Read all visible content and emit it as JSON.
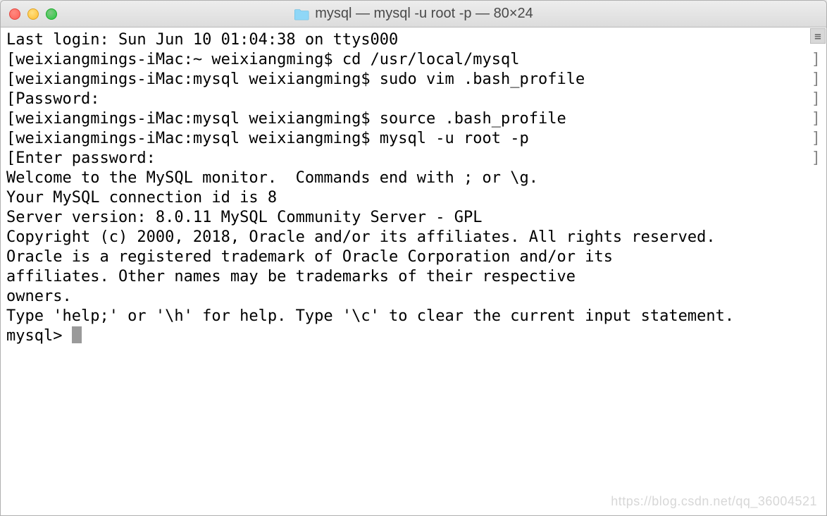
{
  "titlebar": {
    "title": "mysql — mysql -u root -p — 80×24",
    "folder_icon": "folder-icon"
  },
  "terminal": {
    "lines": [
      {
        "bracket": false,
        "text": "Last login: Sun Jun 10 01:04:38 on ttys000"
      },
      {
        "bracket": true,
        "text": "weixiangmings-iMac:~ weixiangming$ cd /usr/local/mysql"
      },
      {
        "bracket": true,
        "text": "weixiangmings-iMac:mysql weixiangming$ sudo vim .bash_profile"
      },
      {
        "bracket": true,
        "text": "Password:"
      },
      {
        "bracket": true,
        "text": "weixiangmings-iMac:mysql weixiangming$ source .bash_profile"
      },
      {
        "bracket": true,
        "text": "weixiangmings-iMac:mysql weixiangming$ mysql -u root -p"
      },
      {
        "bracket": true,
        "text": "Enter password:"
      },
      {
        "bracket": false,
        "text": "Welcome to the MySQL monitor.  Commands end with ; or \\g."
      },
      {
        "bracket": false,
        "text": "Your MySQL connection id is 8"
      },
      {
        "bracket": false,
        "text": "Server version: 8.0.11 MySQL Community Server - GPL"
      },
      {
        "bracket": false,
        "text": ""
      },
      {
        "bracket": false,
        "text": "Copyright (c) 2000, 2018, Oracle and/or its affiliates. All rights reserved."
      },
      {
        "bracket": false,
        "text": ""
      },
      {
        "bracket": false,
        "text": "Oracle is a registered trademark of Oracle Corporation and/or its"
      },
      {
        "bracket": false,
        "text": "affiliates. Other names may be trademarks of their respective"
      },
      {
        "bracket": false,
        "text": "owners."
      },
      {
        "bracket": false,
        "text": ""
      },
      {
        "bracket": false,
        "text": "Type 'help;' or '\\h' for help. Type '\\c' to clear the current input statement."
      },
      {
        "bracket": false,
        "text": ""
      }
    ],
    "prompt": "mysql> ",
    "left_bracket": "[",
    "right_bracket": "]"
  },
  "scroll_indicator_glyph": "≡",
  "watermark": "https://blog.csdn.net/qq_36004521"
}
